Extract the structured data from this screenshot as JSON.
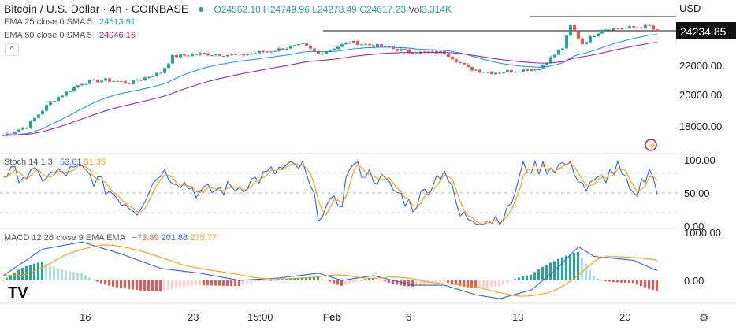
{
  "header": {
    "title": "Bitcoin / U.S. Dollar · 4h · COINBASE",
    "o": "O24562.10",
    "h": "H24749.96",
    "l": "L24278.49",
    "c": "C24617.23",
    "vol_label": "Vol",
    "vol": "3.314K",
    "ema25": {
      "label": "EMA 25 close 0 SMA 5",
      "value": "24513.91"
    },
    "ema50": {
      "label": "EMA 50 close 0 SMA 5",
      "value": "24046.16"
    }
  },
  "currency": "USD",
  "price_label": "24234.85",
  "stoch": {
    "label": "Stoch 14 1 3",
    "k": "53.61",
    "d": "51.35"
  },
  "macd": {
    "label": "MACD 12 26 close 9 EMA EMA",
    "hist": "−73.89",
    "macd": "201.88",
    "signal": "275.77"
  },
  "colors": {
    "up": "#26a69a",
    "down": "#ef5350",
    "ema25": "#2196f3",
    "ema50": "#9c27b0",
    "stochK": "#2962ff",
    "stochD": "#ff9800"
  },
  "chart_data": {
    "type": "line",
    "title": "Bitcoin / U.S. Dollar · 4h · COINBASE",
    "x_ticks": [
      "16",
      "23",
      "15:00",
      "Feb",
      "6",
      "13",
      "20"
    ],
    "price_axis": {
      "ticks": [
        "22000.00",
        "20000.00",
        "18000.00"
      ],
      "ylim": [
        16500,
        25500
      ]
    },
    "price_keypoints": [
      [
        0,
        17200
      ],
      [
        6,
        17800
      ],
      [
        12,
        19500
      ],
      [
        20,
        20800
      ],
      [
        26,
        21000
      ],
      [
        32,
        20800
      ],
      [
        40,
        21500
      ],
      [
        43,
        22600
      ],
      [
        50,
        22800
      ],
      [
        60,
        22700
      ],
      [
        68,
        23000
      ],
      [
        76,
        23400
      ],
      [
        80,
        22800
      ],
      [
        88,
        23600
      ],
      [
        96,
        23300
      ],
      [
        104,
        22900
      ],
      [
        112,
        22900
      ],
      [
        118,
        21800
      ],
      [
        124,
        21500
      ],
      [
        136,
        21800
      ],
      [
        142,
        23200
      ],
      [
        144,
        24700
      ],
      [
        147,
        23500
      ],
      [
        152,
        24500
      ],
      [
        160,
        24600
      ],
      [
        164,
        24700
      ],
      [
        166,
        24234
      ]
    ],
    "stoch_axis": {
      "ticks": [
        "100.00",
        "50.00",
        "0.00"
      ],
      "ylim": [
        0,
        100
      ],
      "bands": [
        80,
        50,
        20
      ]
    },
    "stoch_keypoints": [
      [
        0,
        80
      ],
      [
        10,
        75
      ],
      [
        20,
        85
      ],
      [
        30,
        40
      ],
      [
        34,
        25
      ],
      [
        40,
        85
      ],
      [
        50,
        50
      ],
      [
        60,
        60
      ],
      [
        70,
        85
      ],
      [
        76,
        90
      ],
      [
        80,
        20
      ],
      [
        86,
        40
      ],
      [
        88,
        92
      ],
      [
        96,
        70
      ],
      [
        104,
        30
      ],
      [
        112,
        88
      ],
      [
        116,
        15
      ],
      [
        124,
        10
      ],
      [
        128,
        20
      ],
      [
        132,
        88
      ],
      [
        140,
        90
      ],
      [
        144,
        95
      ],
      [
        148,
        55
      ],
      [
        156,
        88
      ],
      [
        160,
        40
      ],
      [
        164,
        90
      ],
      [
        166,
        52
      ]
    ],
    "macd_axis": {
      "ticks": [
        "1000.00",
        "0.00"
      ]
    },
    "macd_keypoints": [
      [
        0,
        100
      ],
      [
        10,
        650
      ],
      [
        20,
        800
      ],
      [
        30,
        550
      ],
      [
        40,
        250
      ],
      [
        50,
        150
      ],
      [
        60,
        0
      ],
      [
        70,
        50
      ],
      [
        80,
        150
      ],
      [
        86,
        0
      ],
      [
        94,
        100
      ],
      [
        104,
        -100
      ],
      [
        112,
        -100
      ],
      [
        120,
        -300
      ],
      [
        126,
        -380
      ],
      [
        134,
        -200
      ],
      [
        140,
        200
      ],
      [
        146,
        700
      ],
      [
        150,
        500
      ],
      [
        160,
        420
      ],
      [
        166,
        200
      ]
    ]
  }
}
